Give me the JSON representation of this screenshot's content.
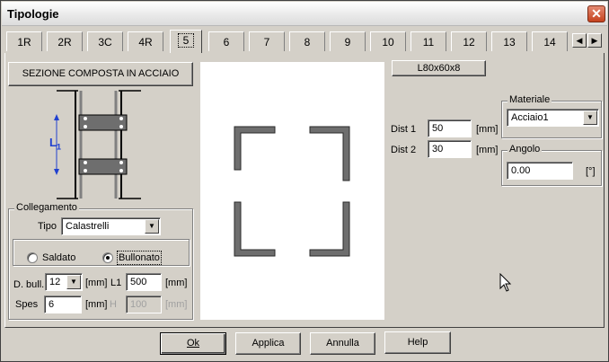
{
  "window": {
    "title": "Tipologie",
    "close_glyph": "✕"
  },
  "tabs": [
    {
      "label": "1R"
    },
    {
      "label": "2R"
    },
    {
      "label": "3C"
    },
    {
      "label": "4R"
    },
    {
      "label": "5",
      "active": true
    },
    {
      "label": "6"
    },
    {
      "label": "7"
    },
    {
      "label": "8"
    },
    {
      "label": "9"
    },
    {
      "label": "10"
    },
    {
      "label": "11"
    },
    {
      "label": "12"
    },
    {
      "label": "13"
    },
    {
      "label": "14"
    }
  ],
  "tab_scroll": {
    "left": "◀",
    "right": "▶"
  },
  "section": {
    "button_label": "SEZIONE COMPOSTA IN ACCIAIO",
    "profile_label": "L80x60x8",
    "l1_marker": "L",
    "l1_sub": "1"
  },
  "collegamento": {
    "title": "Collegamento",
    "tipo_label": "Tipo",
    "tipo_value": "Calastrelli",
    "radio_saldato": "Saldato",
    "radio_bullonato": "Bullonato",
    "selected": "Bullonato",
    "dbull_label": "D. bull.",
    "dbull_value": "12",
    "dbull_unit": "[mm]",
    "l1_label": "L1",
    "l1_value": "500",
    "l1_unit": "[mm]",
    "spes_label": "Spes",
    "spes_value": "6",
    "spes_unit": "[mm]",
    "h_label": "H",
    "h_value": "100",
    "h_unit": "[mm]"
  },
  "dist": {
    "dist1_label": "Dist 1",
    "dist1_value": "50",
    "dist1_unit": "[mm]",
    "dist2_label": "Dist 2",
    "dist2_value": "30",
    "dist2_unit": "[mm]"
  },
  "materiale": {
    "title": "Materiale",
    "value": "Acciaio1"
  },
  "angolo": {
    "title": "Angolo",
    "value": "0.00",
    "unit": "[°]"
  },
  "buttons": {
    "ok": "Ok",
    "applica": "Applica",
    "annulla": "Annulla",
    "help": "Help"
  },
  "colors": {
    "steel": "#6e6e6e",
    "steel_edge": "#2a2a2a",
    "dim_blue": "#2040d0"
  }
}
